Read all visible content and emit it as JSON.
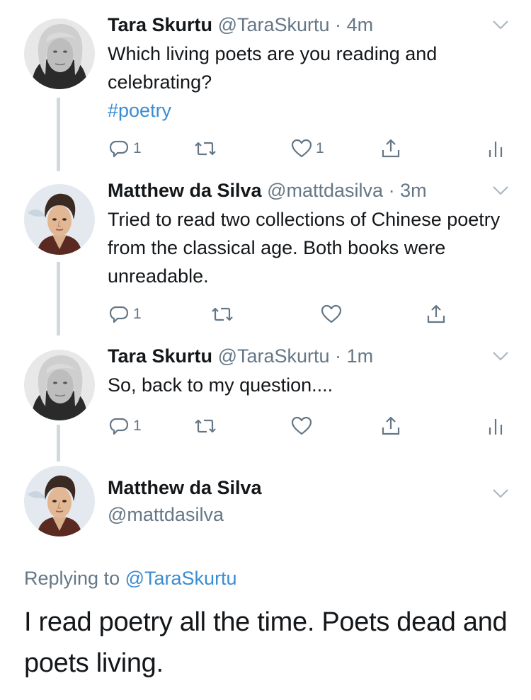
{
  "tweets": [
    {
      "name": "Tara Skurtu",
      "handle": "@TaraSkurtu",
      "separator": "·",
      "time": "4m",
      "text": "Which living poets are you reading and celebrating?",
      "hashtag": "#poetry",
      "reply_count": "1",
      "like_count": "1"
    },
    {
      "name": "Matthew da Silva",
      "handle": "@mattdasilva",
      "separator": "·",
      "time": "3m",
      "text": "Tried to read two collections of Chinese poetry from the classical age. Both books were unreadable.",
      "reply_count": "1"
    },
    {
      "name": "Tara Skurtu",
      "handle": "@TaraSkurtu",
      "separator": "·",
      "time": "1m",
      "text": "So, back to my question....",
      "reply_count": "1"
    }
  ],
  "main_tweet": {
    "name": "Matthew da Silva",
    "handle": "@mattdasilva",
    "replying_prefix": "Replying to",
    "replying_to": "@TaraSkurtu",
    "text": "I read poetry all the time. Poets dead and poets living."
  },
  "icons": {
    "reply": "reply-icon",
    "retweet": "retweet-icon",
    "like": "heart-icon",
    "share": "share-icon",
    "analytics": "analytics-icon",
    "menu": "chevron-down-icon"
  },
  "colors": {
    "link": "#3a8cd3",
    "muted": "#657786",
    "thread_line": "#cfd9de",
    "text": "#14171a"
  }
}
